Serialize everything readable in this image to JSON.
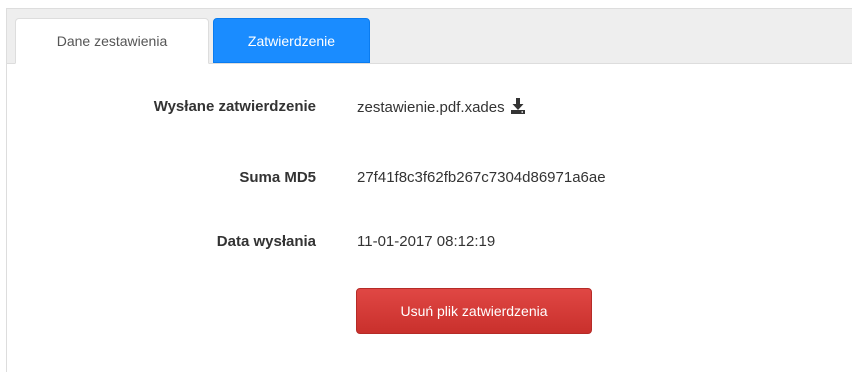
{
  "tabs": [
    {
      "label": "Dane zestawienia",
      "active": false
    },
    {
      "label": "Zatwierdzenie",
      "active": true
    }
  ],
  "details": {
    "sent_approval": {
      "label": "Wysłane zatwierdzenie",
      "value": "zestawienie.pdf.xades",
      "icon": "download-icon"
    },
    "md5": {
      "label": "Suma MD5",
      "value": "27f41f8c3f62fb267c7304d86971a6ae"
    },
    "sent_date": {
      "label": "Data wysłania",
      "value": "11-01-2017 08:12:19"
    }
  },
  "actions": {
    "delete_label": "Usuń plik zatwierdzenia"
  },
  "colors": {
    "active_tab": "#1a8cff",
    "danger_button": "#d9322f",
    "tabbar_bg": "#eeeeee"
  }
}
